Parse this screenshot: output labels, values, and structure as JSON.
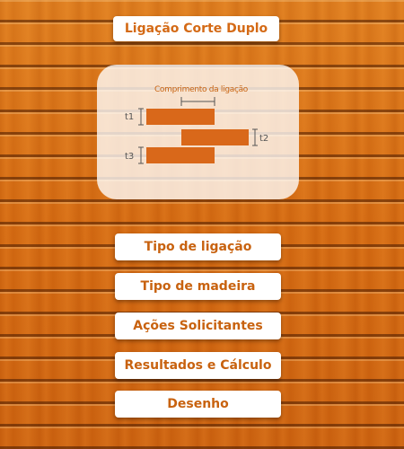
{
  "title": "Ligação Corte Duplo",
  "diagram": {
    "length_label": "Comprimento da ligação",
    "t1_label": "t1",
    "t2_label": "t2",
    "t3_label": "t3",
    "member_color": "#d9681a"
  },
  "menu": {
    "tipo_ligacao": "Tipo de ligação",
    "tipo_madeira": "Tipo de madeira",
    "acoes": "Ações Solicitantes",
    "resultados": "Resultados e Cálculo",
    "desenho": "Desenho"
  },
  "colors": {
    "accent": "#d46a16",
    "wood": "#d96f14"
  }
}
